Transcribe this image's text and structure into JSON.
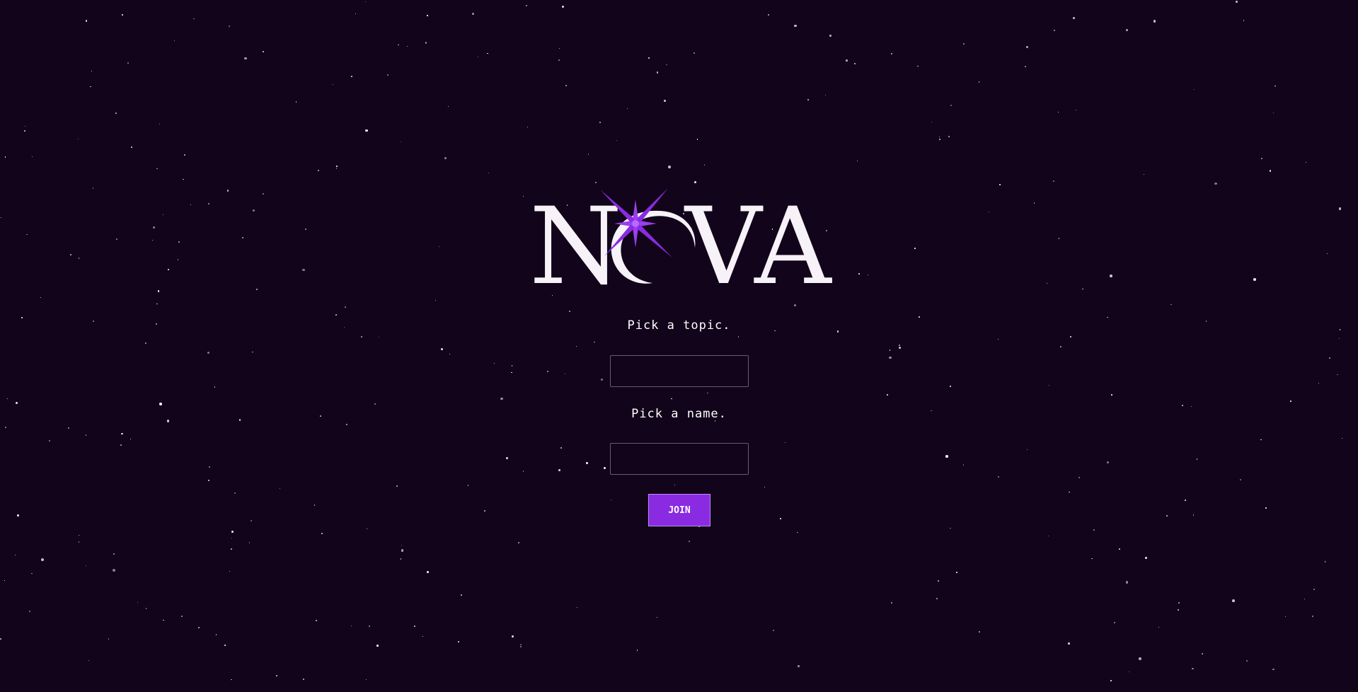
{
  "logo": {
    "text": "NOVA",
    "accent_color": "#8a2be2"
  },
  "form": {
    "topic_prompt": "Pick a topic.",
    "topic_value": "",
    "topic_placeholder": "",
    "name_prompt": "Pick a name.",
    "name_value": "",
    "name_placeholder": "",
    "join_label": "JOIN"
  },
  "theme": {
    "background": "#12041a",
    "button_color": "#8a2be2",
    "text_color": "#ffffff"
  }
}
